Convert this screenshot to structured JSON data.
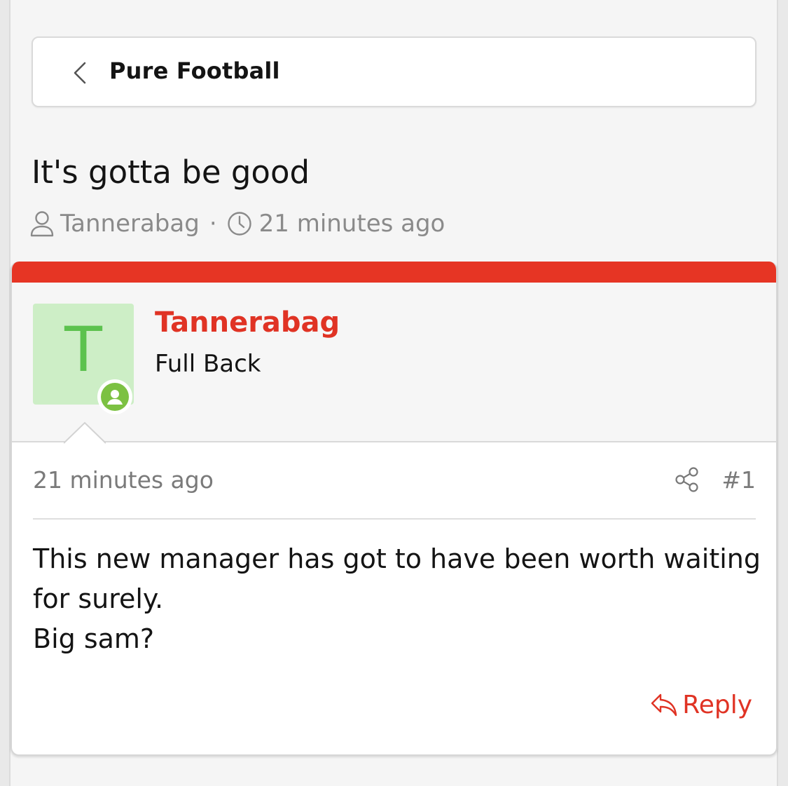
{
  "breadcrumb": {
    "back_icon": "chevron-left-icon",
    "label": "Pure Football"
  },
  "thread": {
    "title": "It's gotta be good",
    "author": "Tannerabag",
    "separator": "·",
    "time": "21 minutes ago",
    "author_icon": "user-icon",
    "time_icon": "clock-icon"
  },
  "post": {
    "accent_color": "#e63524",
    "user": {
      "avatar_letter": "T",
      "avatar_bg": "#cdeec6",
      "avatar_fg": "#5cc24e",
      "online_icon": "online-status-icon",
      "name": "Tannerabag",
      "title": "Full Back"
    },
    "date": "21 minutes ago",
    "share_icon": "share-icon",
    "number": "#1",
    "body_lines": [
      "This new manager has got to have been worth waiting for surely.",
      "Big sam?"
    ],
    "reply_icon": "reply-icon",
    "reply_label": "Reply"
  }
}
